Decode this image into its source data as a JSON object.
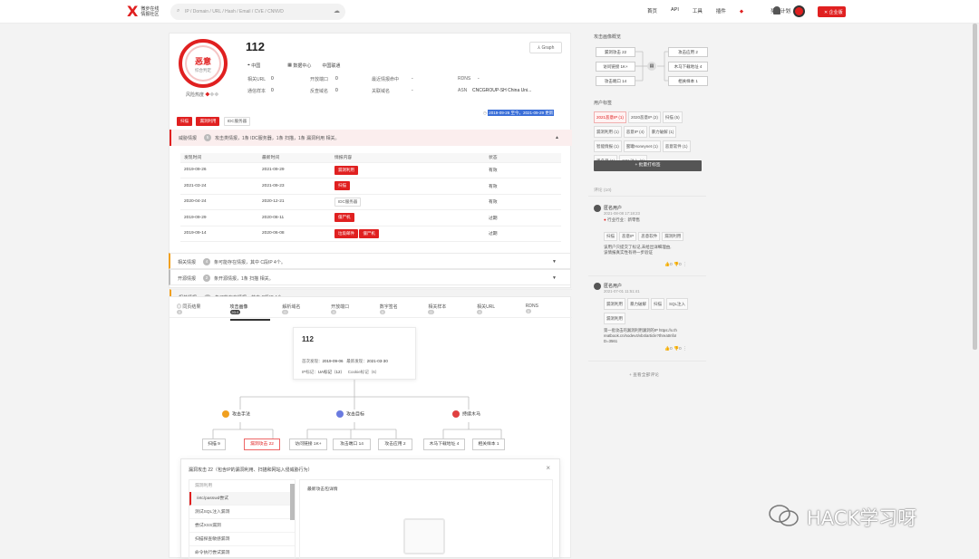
{
  "header": {
    "logo_text1": "微步在线",
    "logo_text2": "情报社区",
    "search_placeholder": "IP / Domain / URL / Hash / Email / CVE / CNNVD",
    "nav": [
      "首页",
      "API",
      "工具",
      "插件",
      "奖励计划"
    ],
    "enterprise": "企业版"
  },
  "main": {
    "verdict": "恶意",
    "verdict_sub": "综合判定",
    "ip": "112",
    "graph": "Graph",
    "location": "中国",
    "dc": "数据中心",
    "isp": "中国联通",
    "stats": [
      [
        "相关URL",
        "0"
      ],
      [
        "开放端口",
        "0"
      ],
      [
        "最近情报命中",
        "-"
      ],
      [
        "通信样本",
        "0"
      ],
      [
        "反查域名",
        "0"
      ],
      [
        "关联域名",
        "-"
      ]
    ],
    "rdns_label": "RDNS",
    "rdns_val": "-",
    "asn_label": "ASN",
    "asn_val": "CNCGROUP-SH China Uni...",
    "sec_label": "风险热度",
    "time_range": "2019-09-26 至今，2021-09-29 更新",
    "top_tags": [
      "扫描",
      "漏洞利用",
      "IDC服务器"
    ],
    "threat_label": "威胁情报",
    "threat_count": "5",
    "threat_summary": "攻击类情报，1条 IDC服务器，1条 扫描，1条 漏洞利用 相关。",
    "table_head": [
      "发现时间",
      "最新时间",
      "情报内容",
      "状态"
    ],
    "rows": [
      {
        "first": "2019-09-26",
        "last": "2021-09-29",
        "tags": [
          "漏洞利用"
        ],
        "status": "有效",
        "st": "ok"
      },
      {
        "first": "2021-03-24",
        "last": "2021-09-23",
        "tags": [
          "扫描"
        ],
        "status": "有效",
        "st": "ok"
      },
      {
        "first": "2020-04-24",
        "last": "2020-12-21",
        "tags": [
          "IDC服务器"
        ],
        "status": "有效",
        "st": "ok"
      },
      {
        "first": "2019-09-29",
        "last": "2020-08-11",
        "tags": [
          "僵尸机"
        ],
        "status": "过期",
        "st": "exp"
      },
      {
        "first": "2019-09-14",
        "last": "2020-06-08",
        "tags": [
          "垃圾邮件",
          "僵尸机"
        ],
        "status": "过期",
        "st": "exp"
      }
    ],
    "rel_label": "相关情报",
    "rel_count": "4",
    "rel_summary": "条可能存在情报，其中 C段IP 4个。",
    "open_label": "开源情报",
    "open_count": "2",
    "open_summary": "条开源情报，1条 扫描 相关。"
  },
  "tabs": {
    "items": [
      [
        "同页结果",
        "0"
      ],
      [
        "攻击画像",
        "93.0"
      ],
      [
        "解析域名",
        "0"
      ],
      [
        "开放端口",
        "0"
      ],
      [
        "数字签名",
        "0"
      ],
      [
        "相关样本",
        "0"
      ],
      [
        "相关URL",
        "0"
      ],
      [
        "RDNS",
        "0"
      ]
    ],
    "node_ip": "112",
    "first_label": "首次发现：",
    "first_val": "2019-09-06",
    "last_label": "最新发现：",
    "last_val": "2021-03-30",
    "ua_label": "IP标记：",
    "ua_val": "UA标记（12）",
    "cookie": "Cookie标记（6）",
    "cats": [
      "攻击手法",
      "攻击目标",
      "持续木马"
    ],
    "leafs": [
      "扫描 9",
      "漏洞攻击 22",
      "访问链接 1K+",
      "攻击端口 14",
      "攻击应用 2",
      "木马下载地址 4",
      "相关样本 1"
    ]
  },
  "panel": {
    "title": "漏洞攻击 22（包含IP的漏洞利用、扫描和网站入侵威胁行为）",
    "col": "漏洞利用",
    "right_title": "最新攻击包详情",
    "items": [
      "/etc/passwd尝试",
      "测试SQL注入漏洞",
      "尝试XSS漏洞",
      "扫描探查敏感漏洞",
      "命令执行尝试漏洞"
    ]
  },
  "right": {
    "flow_title": "攻击画像概览",
    "flow_left": [
      "漏洞攻击 22",
      "访问链接 1K+",
      "攻击端口 14"
    ],
    "flow_right": [
      "攻击应用 2",
      "木马下载地址 4",
      "相关样本 1"
    ],
    "tags_title": "用户标签",
    "tags": [
      "2021恶意IP (1)",
      "2020恶意IP (2)",
      "扫描 (5)",
      "漏洞利用 (1)",
      "恶意IP (4)",
      "暴力破解 (1)",
      "智能情报 (1)",
      "蜜罐Honeynet (1)",
      "恶意软件 (1)",
      "黑名单 (1)",
      "SQL注入 (1)"
    ],
    "add_tags": "+ 批量打标签",
    "comments_title": "评论 (10)",
    "c1": {
      "user": "匿名用户",
      "time": "2021-08-08 17:18:23",
      "line": "行业行业：新零售",
      "tags": [
        "扫描",
        "恶意IP",
        "恶意软件",
        "漏洞利用"
      ],
      "text": "该用户只提交了标记,未给出详细理由,该情报真实性有待一步验证",
      "votes": [
        "0",
        "0"
      ]
    },
    "c2": {
      "user": "匿名用户",
      "time": "2021-07-01 11:51:41",
      "tags": [
        "漏洞利用",
        "暴力破解",
        "扫描",
        "SQL注入",
        "漏洞利用"
      ],
      "text": "第一批攻击的漏洞利用漏洞的IP https://x.threatbook.cn/nodev4/vb4/article?threatInfoID=3561",
      "votes": [
        "0",
        "0"
      ]
    },
    "more": "+ 查看全部评论"
  },
  "watermark": "HACK学习呀",
  "colors": {
    "accent": "#e02020",
    "ok": "#3aa04d"
  }
}
